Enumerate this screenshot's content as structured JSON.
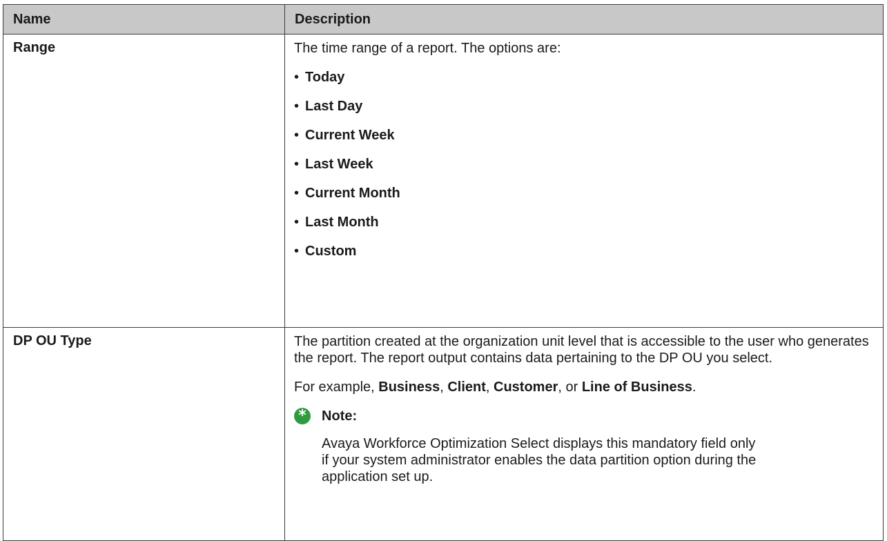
{
  "table": {
    "headers": {
      "name": "Name",
      "description": "Description"
    },
    "rows": [
      {
        "name": "Range",
        "intro": "The time range of a report. The options are:",
        "bullet": "•",
        "options": [
          "Today",
          "Last Day",
          "Current Week",
          "Last Week",
          "Current Month",
          "Last Month",
          "Custom"
        ]
      },
      {
        "name": "DP OU Type",
        "para1": "The partition created at the organization unit level that is accessible to the user who generates the report. The report output contains data pertaining to the DP OU you select.",
        "example": {
          "prefix": "For example, ",
          "items": [
            "Business",
            "Client",
            "Customer",
            "Line of Business"
          ],
          "sep1": ", ",
          "sep2": ", ",
          "sep3": ", or ",
          "suffix": "."
        },
        "note": {
          "icon": "asterisk-note-icon",
          "icon_color": "#2f9a3f",
          "title": "Note:",
          "body": "Avaya Workforce Optimization Select displays this mandatory field only if your system administrator enables the data partition option during the application set up."
        }
      }
    ]
  },
  "colors": {
    "header_bg": "#c8c8c8",
    "border": "#3a3a3a"
  }
}
